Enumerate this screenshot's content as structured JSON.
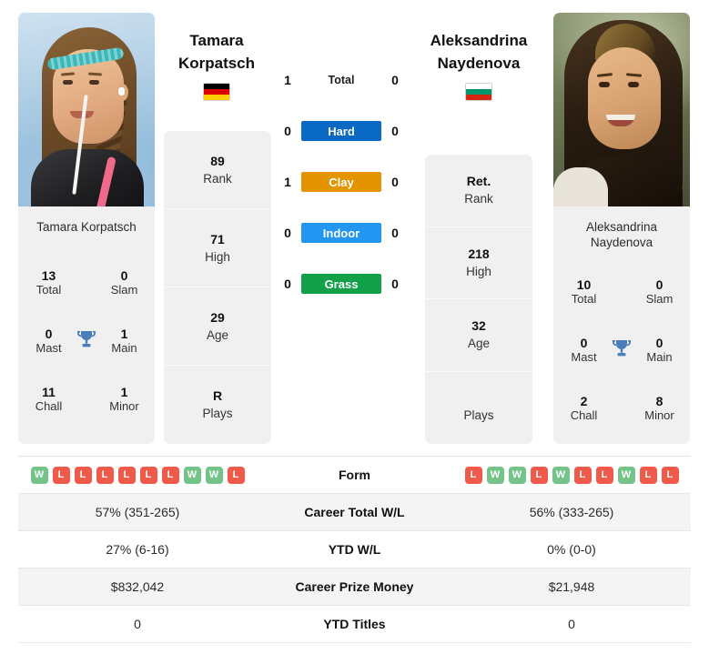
{
  "players": {
    "left": {
      "name_line1": "Tamara",
      "name_line2": "Korpatsch",
      "full_name": "Tamara Korpatsch",
      "country": "Germany",
      "flag_colors": [
        "#000000",
        "#dd0000",
        "#ffce00"
      ],
      "titles": {
        "total_value": "13",
        "total_label": "Total",
        "slam_value": "0",
        "slam_label": "Slam",
        "mast_value": "0",
        "mast_label": "Mast",
        "main_value": "1",
        "main_label": "Main",
        "chall_value": "11",
        "chall_label": "Chall",
        "minor_value": "1",
        "minor_label": "Minor"
      },
      "stats": [
        {
          "value": "89",
          "label": "Rank"
        },
        {
          "value": "71",
          "label": "High"
        },
        {
          "value": "29",
          "label": "Age"
        },
        {
          "value": "R",
          "label": "Plays"
        }
      ],
      "form": [
        "W",
        "L",
        "L",
        "L",
        "L",
        "L",
        "L",
        "W",
        "W",
        "L"
      ],
      "career_total_wl": "57% (351-265)",
      "ytd_wl": "27% (6-16)",
      "career_prize_money": "$832,042",
      "ytd_titles": "0"
    },
    "right": {
      "name_line1": "Aleksandrina",
      "name_line2": "Naydenova",
      "full_name_line1": "Aleksandrina",
      "full_name_line2": "Naydenova",
      "country": "Bulgaria",
      "flag_colors": [
        "#ffffff",
        "#00966e",
        "#d62612"
      ],
      "titles": {
        "total_value": "10",
        "total_label": "Total",
        "slam_value": "0",
        "slam_label": "Slam",
        "mast_value": "0",
        "mast_label": "Mast",
        "main_value": "0",
        "main_label": "Main",
        "chall_value": "2",
        "chall_label": "Chall",
        "minor_value": "8",
        "minor_label": "Minor"
      },
      "stats": [
        {
          "value": "Ret.",
          "label": "Rank"
        },
        {
          "value": "218",
          "label": "High"
        },
        {
          "value": "32",
          "label": "Age"
        },
        {
          "value": "",
          "label": "Plays"
        }
      ],
      "form": [
        "L",
        "W",
        "W",
        "L",
        "W",
        "L",
        "L",
        "W",
        "L",
        "L"
      ],
      "career_total_wl": "56% (333-265)",
      "ytd_wl": "0% (0-0)",
      "career_prize_money": "$21,948",
      "ytd_titles": "0"
    }
  },
  "h2h": [
    {
      "label": "Total",
      "left": "1",
      "right": "0",
      "color": "none"
    },
    {
      "label": "Hard",
      "left": "0",
      "right": "0",
      "color": "#0a69c4"
    },
    {
      "label": "Clay",
      "left": "1",
      "right": "0",
      "color": "#e39400"
    },
    {
      "label": "Indoor",
      "left": "0",
      "right": "0",
      "color": "#2196f3"
    },
    {
      "label": "Grass",
      "left": "0",
      "right": "0",
      "color": "#12a149"
    }
  ],
  "table": {
    "rows": [
      {
        "label": "Form",
        "type": "form"
      },
      {
        "label": "Career Total W/L",
        "type": "text",
        "key": "career_total_wl"
      },
      {
        "label": "YTD W/L",
        "type": "text",
        "key": "ytd_wl"
      },
      {
        "label": "Career Prize Money",
        "type": "text",
        "key": "career_prize_money"
      },
      {
        "label": "YTD Titles",
        "type": "text",
        "key": "ytd_titles"
      }
    ]
  },
  "colors": {
    "win": "#74c48a",
    "loss": "#ef5a4a",
    "trophy": "#4a7ebb",
    "card_bg": "#f0f0f0"
  }
}
